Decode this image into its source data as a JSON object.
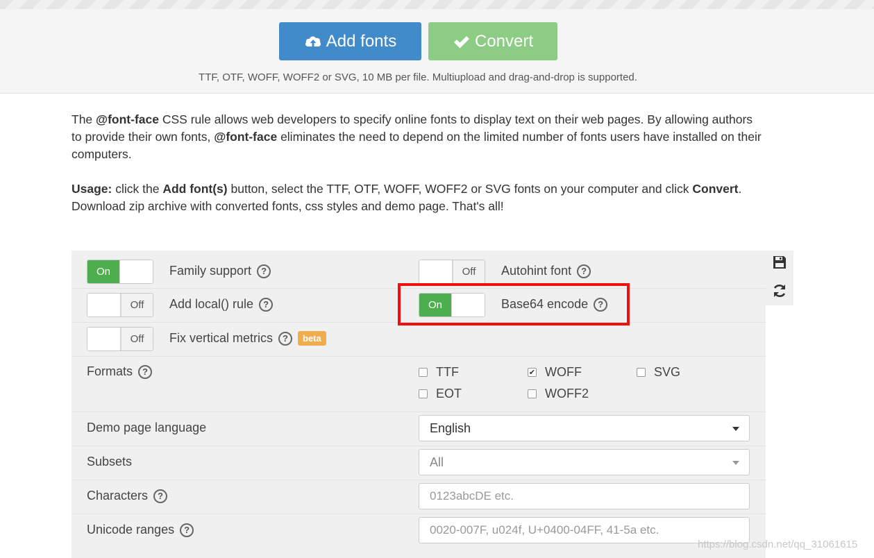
{
  "upload": {
    "add_label": "Add fonts",
    "convert_label": "Convert",
    "hint": "TTF, OTF, WOFF, WOFF2 or SVG, 10 MB per file. Multiupload and drag-and-drop is supported."
  },
  "description": {
    "p1_a": "The ",
    "p1_b": "@font-face",
    "p1_c": " CSS rule allows web developers to specify online fonts to display text on their web pages. By allowing authors to provide their own fonts, ",
    "p1_d": "@font-face",
    "p1_e": " eliminates the need to depend on the limited number of fonts users have installed on their computers.",
    "p2_a": "Usage:",
    "p2_b": " click the ",
    "p2_c": "Add font(s)",
    "p2_d": " button, select the TTF, OTF, WOFF, WOFF2 or SVG fonts on your computer and click ",
    "p2_e": "Convert",
    "p2_f": ". Download zip archive with converted fonts, css styles and demo page. That's all!"
  },
  "options": {
    "family_support": {
      "label": "Family support",
      "state": "On"
    },
    "autohint": {
      "label": "Autohint font",
      "state": "Off"
    },
    "add_local": {
      "label": "Add local() rule",
      "state": "Off"
    },
    "base64": {
      "label": "Base64 encode",
      "state": "On"
    },
    "fix_vertical": {
      "label": "Fix vertical metrics",
      "state": "Off",
      "badge": "beta"
    }
  },
  "formats": {
    "label": "Formats",
    "items": [
      {
        "name": "TTF",
        "checked": false
      },
      {
        "name": "WOFF",
        "checked": true
      },
      {
        "name": "SVG",
        "checked": false
      },
      {
        "name": "EOT",
        "checked": false
      },
      {
        "name": "WOFF2",
        "checked": false
      }
    ]
  },
  "demo_language": {
    "label": "Demo page language",
    "value": "English"
  },
  "subsets": {
    "label": "Subsets",
    "value": "All"
  },
  "characters": {
    "label": "Characters",
    "placeholder": "0123abcDE etc."
  },
  "unicode": {
    "label": "Unicode ranges",
    "placeholder": "0020-007F, u024f, U+0400-04FF, 41-5a etc."
  },
  "help_glyph": "?",
  "watermark": "https://blog.csdn.net/qq_31061615",
  "colors": {
    "primary": "#428bca",
    "success": "#8ccc84",
    "toggle_on": "#4cae4c",
    "highlight": "#ee0f0f",
    "beta": "#f0ad4e"
  },
  "icons": {
    "add": "cloud-upload-icon",
    "convert": "check-icon",
    "save": "save-icon",
    "reset": "refresh-icon",
    "help": "question-circle-icon"
  }
}
